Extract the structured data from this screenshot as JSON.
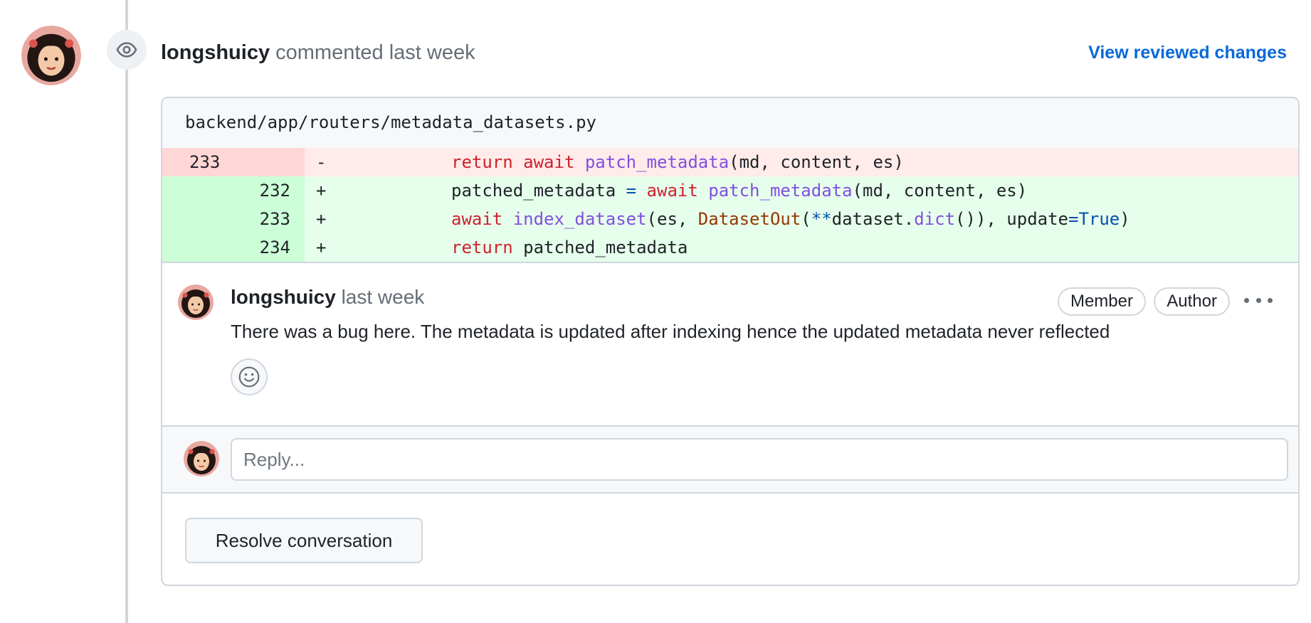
{
  "review": {
    "author": "longshuicy",
    "action_text": "commented last week",
    "view_changes_label": "View reviewed changes"
  },
  "file": {
    "path": "backend/app/routers/metadata_datasets.py"
  },
  "diff": {
    "lines": [
      {
        "type": "del",
        "old_num": "233",
        "new_num": "",
        "marker": "-"
      },
      {
        "type": "add",
        "old_num": "",
        "new_num": "232",
        "marker": "+"
      },
      {
        "type": "add",
        "old_num": "",
        "new_num": "233",
        "marker": "+"
      },
      {
        "type": "add",
        "old_num": "",
        "new_num": "234",
        "marker": "+"
      }
    ],
    "tokens": {
      "l1_return": "return",
      "l1_await": "await",
      "l1_fn": "patch_metadata",
      "l1_args": "(md, content, es)",
      "l2_var": "patched_metadata ",
      "l2_eq": "=",
      "l2_sp": " ",
      "l2_await": "await",
      "l2_fn": "patch_metadata",
      "l2_args": "(md, content, es)",
      "l3_await": "await",
      "l3_fn": "index_dataset",
      "l3_a": "(es, ",
      "l3_cls": "DatasetOut",
      "l3_b": "(",
      "l3_star": "**",
      "l3_c": "dataset.",
      "l3_dict": "dict",
      "l3_d": "()), update",
      "l3_eq": "=",
      "l3_true": "True",
      "l3_e": ")",
      "l4_return": "return",
      "l4_var": "patched_metadata"
    }
  },
  "comment": {
    "author": "longshuicy",
    "time": "last week",
    "badges": [
      "Member",
      "Author"
    ],
    "body": "There was a bug here. The metadata is updated after indexing hence the updated metadata never reflected"
  },
  "reply": {
    "placeholder": "Reply..."
  },
  "resolve_label": "Resolve conversation",
  "colors": {
    "link": "#0969da",
    "deletion_bg": "#ffebe9",
    "addition_bg": "#e6ffec",
    "keyword": "#cf222e",
    "function": "#8250df"
  },
  "icons": [
    "eye-icon",
    "smiley-icon",
    "kebab-horizontal-icon"
  ]
}
